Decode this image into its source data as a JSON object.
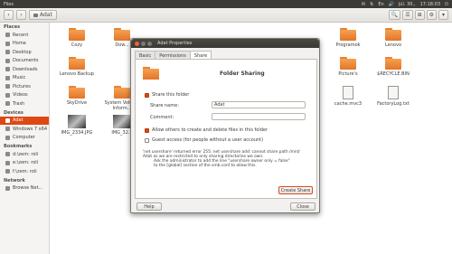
{
  "topbar": {
    "title": "Files",
    "clock": "17:18:03",
    "date": "júl. 30.,",
    "indicators": [
      "✉",
      "⇅",
      "En",
      "🔊"
    ],
    "power_icon": "⏻"
  },
  "toolbar": {
    "back": "‹",
    "forward": "›",
    "location": "Adat",
    "buttons": [
      "🔍",
      "☰",
      "⊞",
      "⚙",
      "▾"
    ]
  },
  "sidebar": {
    "sections": [
      {
        "heading": "Places",
        "items": [
          {
            "label": "Recent",
            "icon": "clock-icon"
          },
          {
            "label": "Home",
            "icon": "home-icon"
          },
          {
            "label": "Desktop",
            "icon": "desktop-icon"
          },
          {
            "label": "Documents",
            "icon": "documents-icon"
          },
          {
            "label": "Downloads",
            "icon": "download-icon"
          },
          {
            "label": "Music",
            "icon": "music-icon"
          },
          {
            "label": "Pictures",
            "icon": "pictures-icon"
          },
          {
            "label": "Videos",
            "icon": "videos-icon"
          },
          {
            "label": "Trash",
            "icon": "trash-icon"
          }
        ]
      },
      {
        "heading": "Devices",
        "items": [
          {
            "label": "Adat",
            "icon": "drive-icon",
            "selected": true
          },
          {
            "label": "Windows 7 x64",
            "icon": "drive-icon"
          },
          {
            "label": "Computer",
            "icon": "computer-icon"
          }
        ]
      },
      {
        "heading": "Bookmarks",
        "items": [
          {
            "label": "d:\\zem: roli",
            "icon": "folder-icon"
          },
          {
            "label": "e:\\zem: roli",
            "icon": "folder-icon"
          },
          {
            "label": "f:\\zem: roli",
            "icon": "folder-icon"
          }
        ]
      },
      {
        "heading": "Network",
        "items": [
          {
            "label": "Browse Net...",
            "icon": "network-icon"
          }
        ]
      }
    ]
  },
  "files": [
    {
      "label": "Cozy",
      "kind": "folder"
    },
    {
      "label": "Dow...",
      "kind": "folder"
    },
    {
      "label": "Programok",
      "kind": "folder"
    },
    {
      "label": "Lenovo",
      "kind": "folder"
    },
    {
      "label": "Lenovo Backup",
      "kind": "folder"
    },
    {
      "label": "Picture's",
      "kind": "folder"
    },
    {
      "label": "$RECYCLE.BIN",
      "kind": "folder"
    },
    {
      "label": "SkyDrive",
      "kind": "folder"
    },
    {
      "label": "System Volume Inform...",
      "kind": "folder"
    },
    {
      "label": "cache.mvc3",
      "kind": "doc"
    },
    {
      "label": "FactoryLog.txt",
      "kind": "doc"
    },
    {
      "label": "IMG_2334.JPG",
      "kind": "photo"
    },
    {
      "label": "IMG_32...",
      "kind": "photo"
    }
  ],
  "dialog": {
    "title": "Adat Properties",
    "tabs": [
      "Basic",
      "Permissions",
      "Share"
    ],
    "header": "Folder Sharing",
    "share_this_folder": "Share this folder",
    "share_name_label": "Share name:",
    "share_name_value": "Adat",
    "comment_label": "Comment:",
    "comment_value": "",
    "allow_others": "Allow others to create and delete files in this folder",
    "guest_access": "Guest access (for people without a user account)",
    "error_lines": [
      "'net usershare' returned error 255: net usershare add: cannot share path /mnt/",
      "Adat as we are restricted to only sharing directories we own.",
      "Ask the administrator to add the line \"usershare owner only = false\"",
      "to the [global] section of the smb.conf to allow this."
    ],
    "create_share": "Create Share",
    "help": "Help",
    "close": "Close"
  }
}
